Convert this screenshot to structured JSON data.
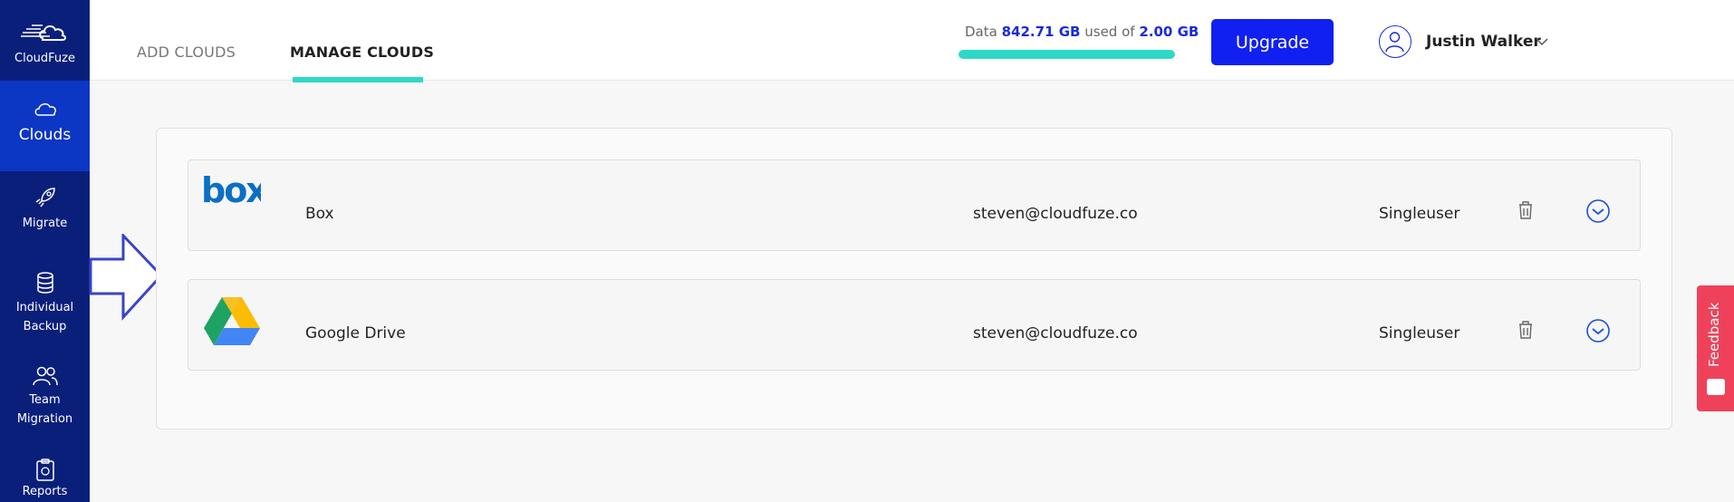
{
  "brand": {
    "name": "CloudFuze"
  },
  "sidebar": {
    "items": [
      {
        "label": "Clouds",
        "icon": "cloud-icon",
        "active": true
      },
      {
        "label": "Migrate",
        "icon": "rocket-icon"
      },
      {
        "label": "Individual Backup",
        "icon": "database-icon"
      },
      {
        "label": "Team Migration",
        "icon": "users-icon"
      },
      {
        "label": "Reports",
        "icon": "clipboard-icon"
      }
    ]
  },
  "header": {
    "tabs": [
      {
        "label": "ADD CLOUDS",
        "active": false
      },
      {
        "label": "MANAGE CLOUDS",
        "active": true
      }
    ],
    "usage": {
      "prefix": "Data",
      "used": "842.71 GB",
      "middle": "used of",
      "total": "2.00 GB",
      "fill_fraction": 1.0
    },
    "upgrade_label": "Upgrade",
    "user_name": "Justin Walker"
  },
  "clouds": [
    {
      "name": "Box",
      "email": "steven@cloudfuze.co",
      "type": "Singleuser",
      "logo": "box-logo"
    },
    {
      "name": "Google Drive",
      "email": "steven@cloudfuze.co",
      "type": "Singleuser",
      "logo": "google-drive-logo"
    }
  ],
  "feedback_label": "Feedback",
  "colors": {
    "sidebar": "#0a1f7a",
    "active": "#0c36c4",
    "accent": "#2ed8c7",
    "upgrade": "#1020f0",
    "feedback": "#f0415b"
  }
}
